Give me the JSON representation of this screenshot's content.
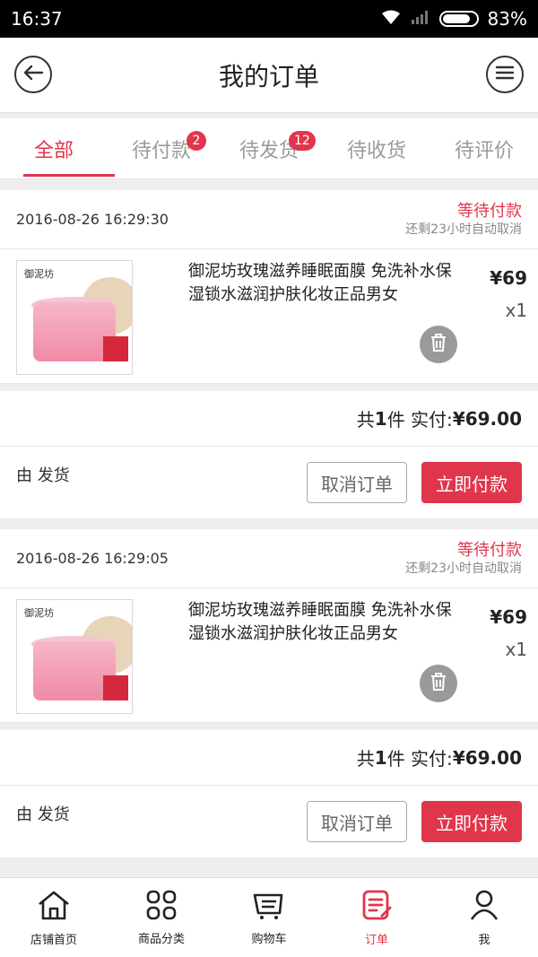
{
  "status_bar": {
    "time": "16:37",
    "battery": "83%"
  },
  "header": {
    "title": "我的订单"
  },
  "tabs": [
    {
      "label": "全部",
      "badge": ""
    },
    {
      "label": "待付款",
      "badge": "2"
    },
    {
      "label": "待发货",
      "badge": "12"
    },
    {
      "label": "待收货",
      "badge": ""
    },
    {
      "label": "待评价",
      "badge": ""
    }
  ],
  "orders": [
    {
      "date": "2016-08-26 16:29:30",
      "status": "等待付款",
      "status_sub": "还剩23小时自动取消",
      "item": {
        "brand": "御泥坊",
        "title": "御泥坊玫瑰滋养睡眠面膜 免洗补水保湿锁水滋润护肤化妆正品男女",
        "price": "¥69",
        "qty": "x1"
      },
      "total_prefix": "共",
      "total_count": "1",
      "total_mid": " 件 实付:",
      "total_amount": "¥69.00",
      "ship": "由  发货",
      "cancel_label": "取消订单",
      "pay_label": "立即付款"
    },
    {
      "date": "2016-08-26 16:29:05",
      "status": "等待付款",
      "status_sub": "还剩23小时自动取消",
      "item": {
        "brand": "御泥坊",
        "title": "御泥坊玫瑰滋养睡眠面膜 免洗补水保湿锁水滋润护肤化妆正品男女",
        "price": "¥69",
        "qty": "x1"
      },
      "total_prefix": "共",
      "total_count": "1",
      "total_mid": " 件 实付:",
      "total_amount": "¥69.00",
      "ship": "由  发货",
      "cancel_label": "取消订单",
      "pay_label": "立即付款"
    }
  ],
  "bottom_nav": [
    {
      "label": "店铺首页",
      "icon": "home-icon"
    },
    {
      "label": "商品分类",
      "icon": "grid-icon"
    },
    {
      "label": "购物车",
      "icon": "cart-icon"
    },
    {
      "label": "订单",
      "icon": "order-icon"
    },
    {
      "label": "我",
      "icon": "user-icon"
    }
  ],
  "colors": {
    "accent": "#e0364b",
    "muted": "#9a9a9a"
  }
}
